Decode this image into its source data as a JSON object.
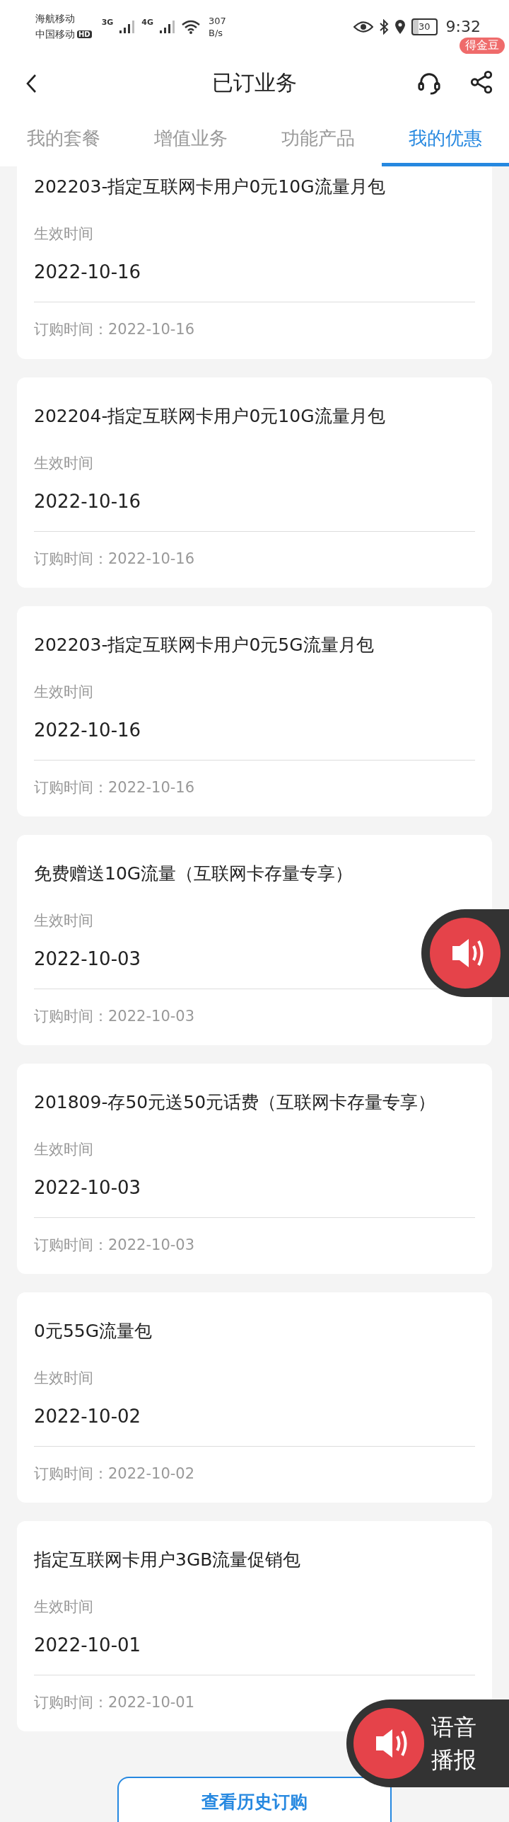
{
  "status_bar": {
    "carrier_1": "海航移动",
    "carrier_2": "中国移动",
    "hd_badge": "HD",
    "network_1": "3G",
    "network_2": "4G",
    "speed_value": "307",
    "speed_unit": "B/s",
    "battery": "30",
    "time": "9:32"
  },
  "header": {
    "title": "已订业务",
    "reward_badge": "得金豆"
  },
  "tabs": [
    {
      "label": "我的套餐",
      "selected": false
    },
    {
      "label": "增值业务",
      "selected": false
    },
    {
      "label": "功能产品",
      "selected": false
    },
    {
      "label": "我的优惠",
      "selected": true
    }
  ],
  "offers": [
    {
      "name": "202203-指定互联网卡用户0元10G流量月包",
      "effective_label": "生效时间",
      "effective_date": "2022-10-16",
      "order_time": "订购时间：2022-10-16"
    },
    {
      "name": "202204-指定互联网卡用户0元10G流量月包",
      "effective_label": "生效时间",
      "effective_date": "2022-10-16",
      "order_time": "订购时间：2022-10-16"
    },
    {
      "name": "202203-指定互联网卡用户0元5G流量月包",
      "effective_label": "生效时间",
      "effective_date": "2022-10-16",
      "order_time": "订购时间：2022-10-16"
    },
    {
      "name": "免费赠送10G流量（互联网卡存量专享）",
      "effective_label": "生效时间",
      "effective_date": "2022-10-03",
      "order_time": "订购时间：2022-10-03"
    },
    {
      "name": "201809-存50元送50元话费（互联网卡存量专享）",
      "effective_label": "生效时间",
      "effective_date": "2022-10-03",
      "order_time": "订购时间：2022-10-03"
    },
    {
      "name": "0元55G流量包",
      "effective_label": "生效时间",
      "effective_date": "2022-10-02",
      "order_time": "订购时间：2022-10-02"
    },
    {
      "name": "指定互联网卡用户3GB流量促销包",
      "effective_label": "生效时间",
      "effective_date": "2022-10-01",
      "order_time": "订购时间：2022-10-01"
    }
  ],
  "voice_widget": {
    "line_1": "语音",
    "line_2": "播报"
  },
  "history_button": "查看历史订购"
}
